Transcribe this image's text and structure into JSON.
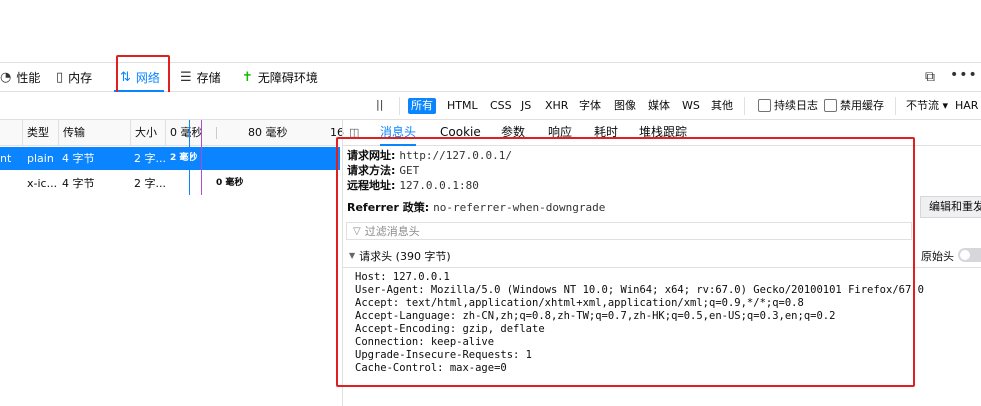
{
  "toolbar": {
    "tabs": [
      {
        "label": "性能",
        "icon": "performance-icon"
      },
      {
        "label": "内存",
        "icon": "memory-icon"
      },
      {
        "label": "网络",
        "icon": "network-icon"
      },
      {
        "label": "存储",
        "icon": "storage-icon"
      },
      {
        "label": "无障碍环境",
        "icon": "accessibility-icon"
      }
    ],
    "active_tab": "网络",
    "right_icons": [
      "responsive-design-icon",
      "more-options-icon"
    ]
  },
  "filters": {
    "pause": "||",
    "types": [
      "所有",
      "HTML",
      "CSS",
      "JS",
      "XHR",
      "字体",
      "图像",
      "媒体",
      "WS",
      "其他"
    ],
    "active_type": "所有",
    "persist_logs": "持续日志",
    "disable_cache": "禁用缓存",
    "throttle": "不节流 ▾",
    "har": "HAR"
  },
  "table": {
    "headers": {
      "type": "类型",
      "transfer": "传输",
      "size": "大小",
      "t0": "0 毫秒",
      "t80": "80 毫秒",
      "t160": "16"
    },
    "rows": [
      {
        "file": "nt",
        "type": "plain",
        "transfer": "4 字节",
        "size": "2 字...",
        "time": "2 毫秒"
      },
      {
        "file": "",
        "type": "x-ic...",
        "transfer": "4 字节",
        "size": "2 字...",
        "time": "0 毫秒"
      }
    ]
  },
  "details": {
    "tabs": [
      "消息头",
      "Cookie",
      "参数",
      "响应",
      "耗时",
      "堆栈跟踪"
    ],
    "active_tab": "消息头",
    "request_url_label": "请求网址:",
    "request_url": "http://127.0.0.1/",
    "request_method_label": "请求方法:",
    "request_method": "GET",
    "remote_address_label": "远程地址:",
    "remote_address": "127.0.0.1:80",
    "referrer_label": "Referrer 政策:",
    "referrer": "no-referrer-when-downgrade",
    "edit_resend": "编辑和重发",
    "filter_placeholder": "过滤消息头",
    "request_headers_title": "请求头 (390 字节)",
    "raw_headers": "原始头",
    "raw_lines": [
      "Host: 127.0.0.1",
      "User-Agent: Mozilla/5.0 (Windows NT 10.0; Win64; x64; rv:67.0) Gecko/20100101 Firefox/67.0",
      "Accept: text/html,application/xhtml+xml,application/xml;q=0.9,*/*;q=0.8",
      "Accept-Language: zh-CN,zh;q=0.8,zh-TW;q=0.7,zh-HK;q=0.5,en-US;q=0.3,en;q=0.2",
      "Accept-Encoding: gzip, deflate",
      "Connection: keep-alive",
      "Upgrade-Insecure-Requests: 1",
      "Cache-Control: max-age=0"
    ]
  },
  "colors": {
    "accent": "#0a84ff",
    "highlight_box": "#e02020"
  }
}
